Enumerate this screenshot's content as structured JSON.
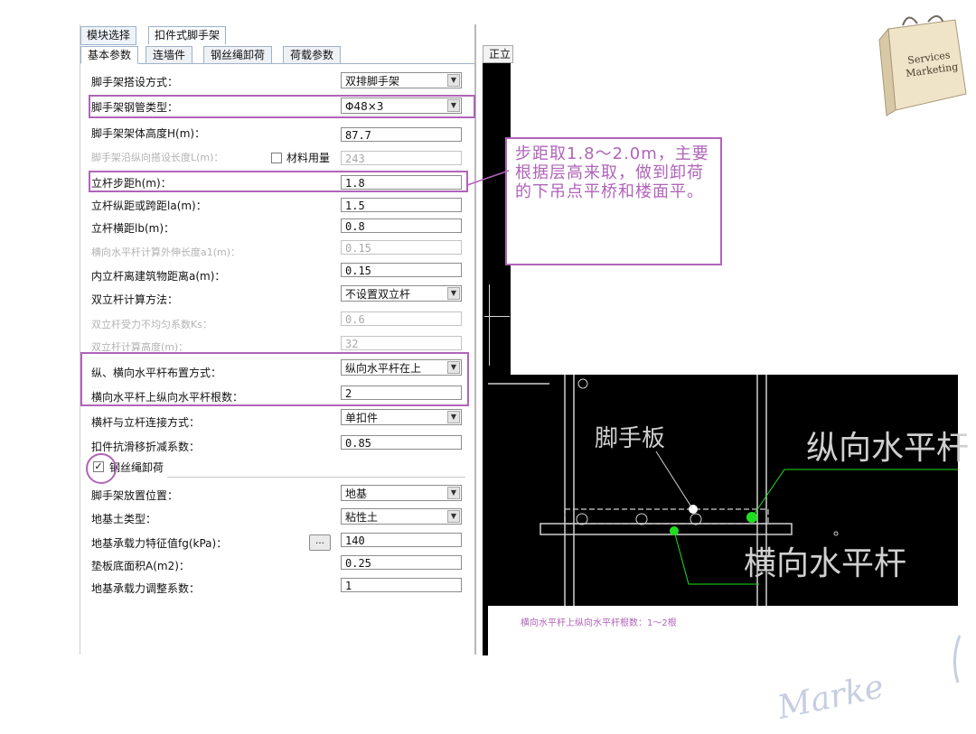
{
  "top_tabs": [
    "模块选择",
    "扣件式脚手架"
  ],
  "sub_tabs": [
    "基本参数",
    "连墙件",
    "钢丝绳卸荷",
    "荷载参数"
  ],
  "view_tab": "正立",
  "rows": {
    "erect_mode": {
      "label": "脚手架搭设方式：",
      "value": "双排脚手架"
    },
    "pipe_type": {
      "label": "脚手架钢管类型：",
      "value": "Φ48×3"
    },
    "height": {
      "label": "脚手架架体高度H(m)：",
      "value": "87.7"
    },
    "length": {
      "label": "脚手架沿纵向搭设长度L(m)：",
      "value": "243",
      "checkbox_label": "材料用量"
    },
    "step": {
      "label": "立杆步距h(m)：",
      "value": "1.8"
    },
    "la": {
      "label": "立杆纵距或跨距la(m)：",
      "value": "1.5"
    },
    "lb": {
      "label": "立杆横距lb(m)：",
      "value": "0.8"
    },
    "a1": {
      "label": "横向水平杆计算外伸长度a1(m)：",
      "value": "0.15"
    },
    "a": {
      "label": "内立杆离建筑物距离a(m)：",
      "value": "0.15"
    },
    "double_method": {
      "label": "双立杆计算方法：",
      "value": "不设置双立杆"
    },
    "ks": {
      "label": "双立杆受力不均匀系数Ks：",
      "value": "0.6"
    },
    "double_height": {
      "label": "双立杆计算高度(m)：",
      "value": "32"
    },
    "layout": {
      "label": "纵、横向水平杆布置方式：",
      "value": "纵向水平杆在上"
    },
    "count": {
      "label": "横向水平杆上纵向水平杆根数：",
      "value": "2"
    },
    "connect": {
      "label": "横杆与立杆连接方式：",
      "value": "单扣件"
    },
    "slip": {
      "label": "扣件抗滑移折减系数：",
      "value": "0.85"
    },
    "wire": {
      "label": "钢丝绳卸荷"
    },
    "location": {
      "label": "脚手架放置位置：",
      "value": "地基"
    },
    "soil": {
      "label": "地基土类型：",
      "value": "粘性土"
    },
    "fg": {
      "label": "地基承载力特征值fg(kPa)：",
      "value": "140",
      "button": "…"
    },
    "area": {
      "label": "垫板底面积A(m2)：",
      "value": "0.25"
    },
    "adjust": {
      "label": "地基承载力调整系数：",
      "value": "1"
    }
  },
  "callout": "步距取1.8～2.0m，主要根据层高来取，做到卸荷的下吊点平桥和楼面平。",
  "cad": {
    "board_label": "脚手板",
    "longitudinal_label": "纵向水平杆",
    "transverse_label": "横向水平杆",
    "footnote": "横向水平杆上纵向水平杆根数：1～2根"
  },
  "bag_text": [
    "Services",
    "Marketing"
  ],
  "watermark": "Marke",
  "colors": {
    "highlight": "#b064b8",
    "callout_text": "#b064b8",
    "cad_bg": "#000000",
    "green_point": "#1fe01f"
  }
}
